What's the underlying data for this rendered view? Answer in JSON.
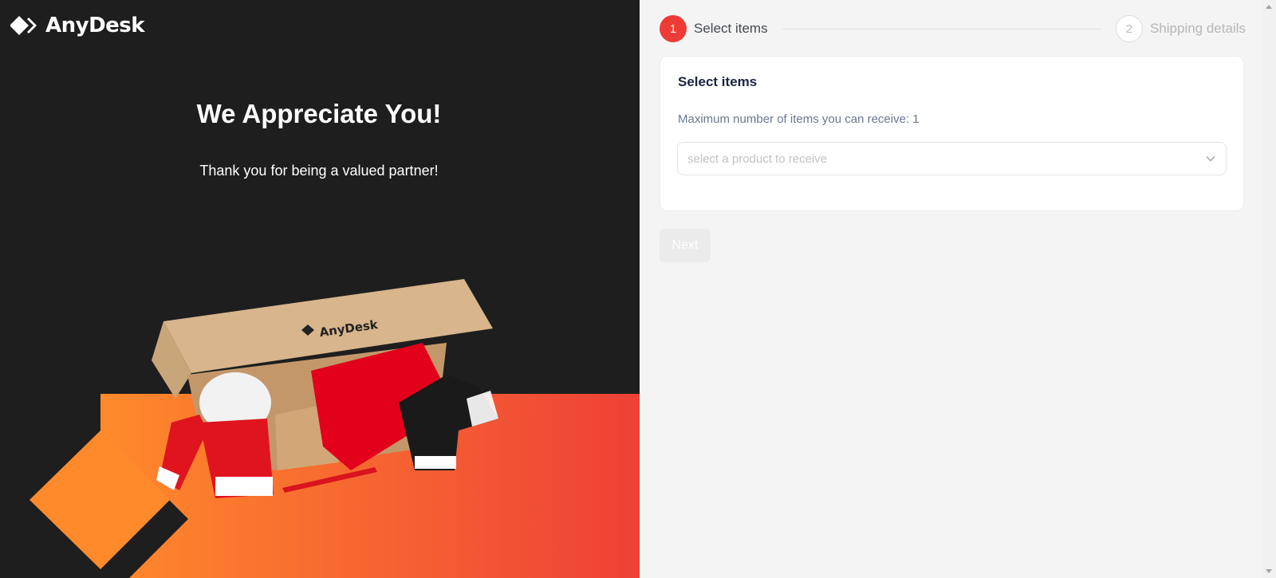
{
  "brand": {
    "name": "AnyDesk"
  },
  "hero": {
    "title": "We Appreciate You!",
    "subtitle": "Thank you for being a valued partner!"
  },
  "stepper": {
    "steps": [
      {
        "number": "1",
        "label": "Select items",
        "state": "active"
      },
      {
        "number": "2",
        "label": "Shipping details",
        "state": "inactive"
      }
    ]
  },
  "card": {
    "title": "Select items",
    "max_items_note": "Maximum number of items you can receive: 1",
    "product_select": {
      "placeholder": "select a product to receive"
    }
  },
  "actions": {
    "next_label": "Next"
  },
  "colors": {
    "accent": "#ef3b36",
    "left_bg": "#1e1e1e",
    "gradient_start": "#ff8a2b",
    "gradient_end": "#ee4037"
  }
}
